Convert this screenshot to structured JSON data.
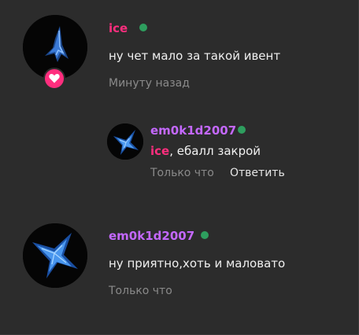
{
  "colors": {
    "background": "#2c2c2c",
    "name_pink": "#ff2e7e",
    "name_purple": "#c468ff",
    "online_green": "#2e9e5e",
    "badge_pink": "#ff2e7e"
  },
  "comments": [
    {
      "author": "ice",
      "online": true,
      "badge_icon": "heart-icon",
      "text": "ну чет мало за такой ивент",
      "time": "Минуту назад"
    },
    {
      "author": "em0k1d2007",
      "online": true,
      "mention": "ice",
      "text_after_mention": ", ебалл закрой",
      "time": "Только что",
      "reply_label": "Ответить"
    },
    {
      "author": "em0k1d2007",
      "online": true,
      "text": "ну приятно,хоть и маловато",
      "time": "Только что"
    }
  ]
}
